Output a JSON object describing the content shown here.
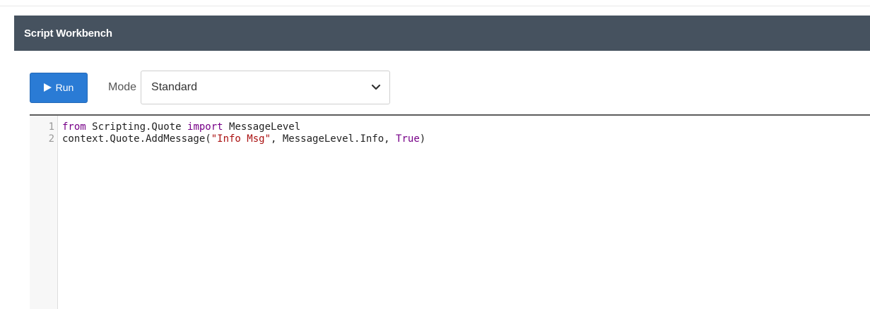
{
  "header": {
    "title": "Script Workbench"
  },
  "toolbar": {
    "run_label": "Run",
    "mode_label": "Mode",
    "mode_selected": "Standard"
  },
  "editor": {
    "lines": [
      {
        "number": "1",
        "tokens": [
          {
            "text": "from",
            "kind": "keyword"
          },
          {
            "text": " Scripting.Quote ",
            "kind": "plain"
          },
          {
            "text": "import",
            "kind": "keyword"
          },
          {
            "text": " MessageLevel",
            "kind": "plain"
          }
        ]
      },
      {
        "number": "2",
        "tokens": [
          {
            "text": "context.Quote.AddMessage(",
            "kind": "plain"
          },
          {
            "text": "\"Info Msg\"",
            "kind": "string"
          },
          {
            "text": ", MessageLevel.Info, ",
            "kind": "plain"
          },
          {
            "text": "True",
            "kind": "keyword"
          },
          {
            "text": ")",
            "kind": "plain"
          }
        ]
      }
    ]
  },
  "colors": {
    "header_bg": "#46525f",
    "run_button_bg": "#2a7bd5",
    "keyword": "#770088",
    "string": "#aa1111"
  },
  "icons": {
    "run": "play-icon",
    "select": "chevron-down-icon"
  }
}
